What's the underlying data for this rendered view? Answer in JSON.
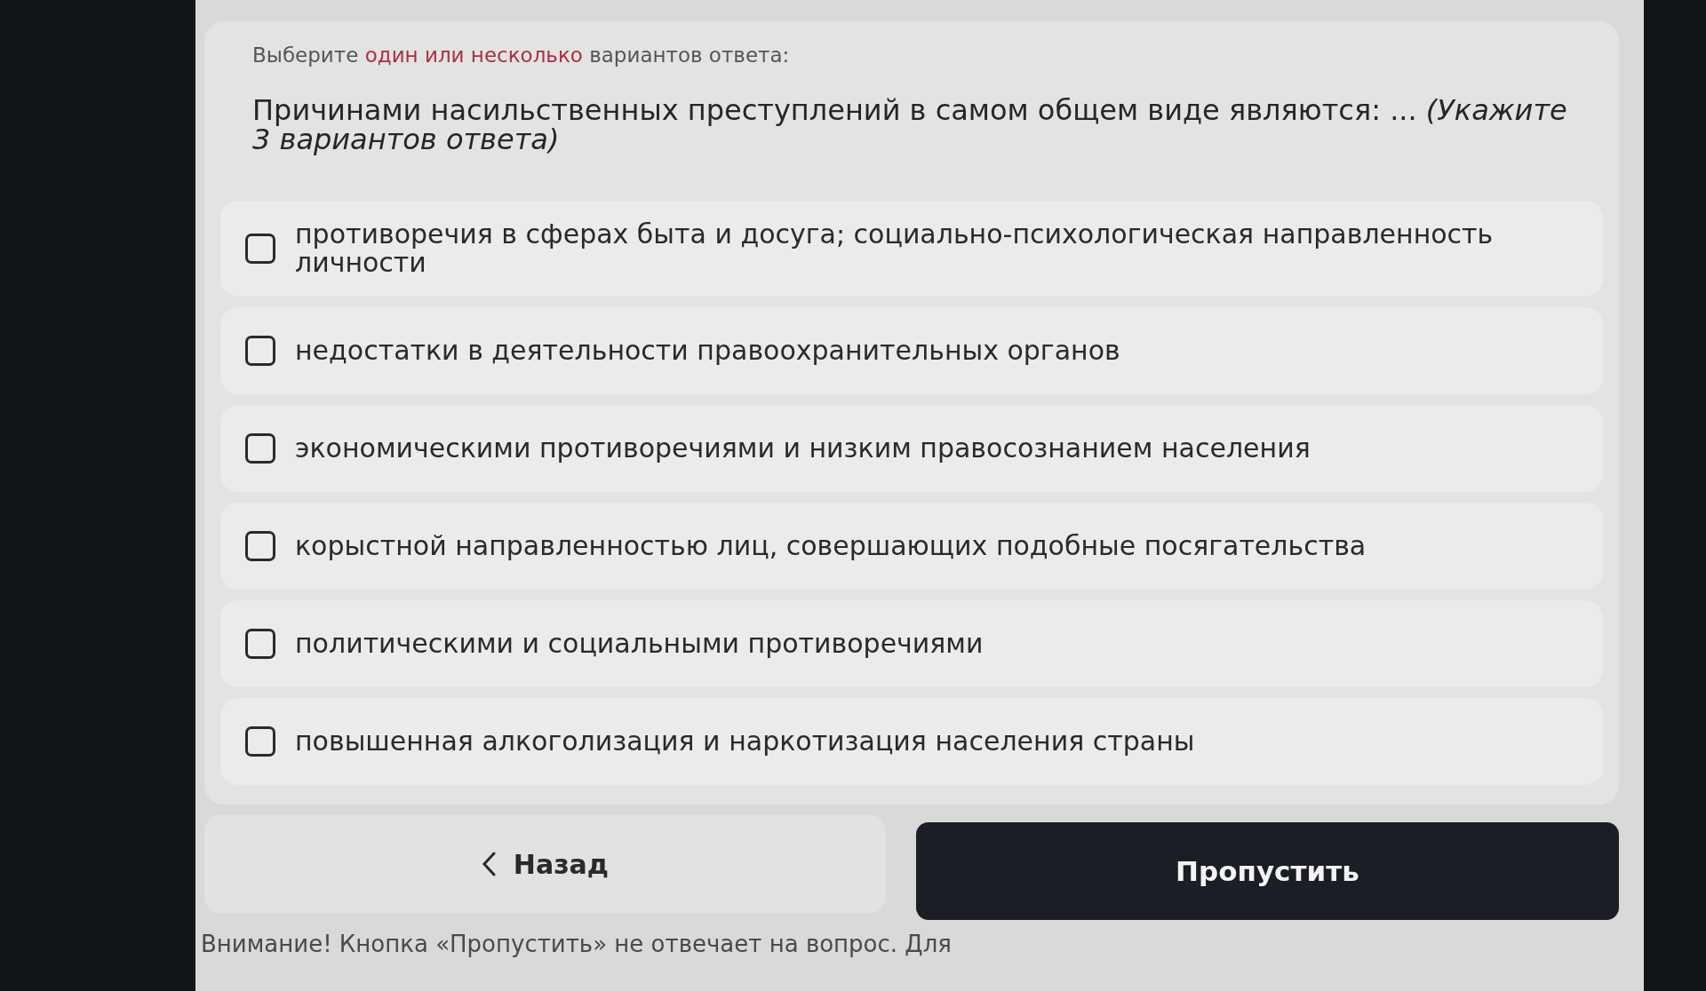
{
  "instruction": [
    {
      "text": "Выберите",
      "highlighted": false
    },
    {
      "text": "один или несколько",
      "highlighted": true
    },
    {
      "text": "вариантов ответа:",
      "highlighted": false
    }
  ],
  "question": "Причинами насильственных преступлений в самом общем виде являются: ... *(Укажите 3 вариантов ответа)*",
  "options": [
    {
      "text": "противоречия в сферах быта и досуга; социально-психологическая направленность личности",
      "checked": false
    },
    {
      "text": "недостатки в деятельности правоохранительных органов",
      "checked": false
    },
    {
      "text": "экономическими противоречиями и низким правосознанием населения",
      "checked": false
    },
    {
      "text": "корыстной направленностью лиц, совершающих подобные посягательства",
      "checked": false
    },
    {
      "text": "политическими и социальными противоречиями",
      "checked": false
    },
    {
      "text": "повышенная алкоголизация и наркотизация населения страны",
      "checked": false
    }
  ],
  "buttons": [
    {
      "kind": "back",
      "label": "Назад"
    },
    {
      "kind": "skip",
      "label": "Пропустить"
    }
  ],
  "notice": "Внимание! Кнопка «Пропустить» не отвечает на вопрос. Для"
}
